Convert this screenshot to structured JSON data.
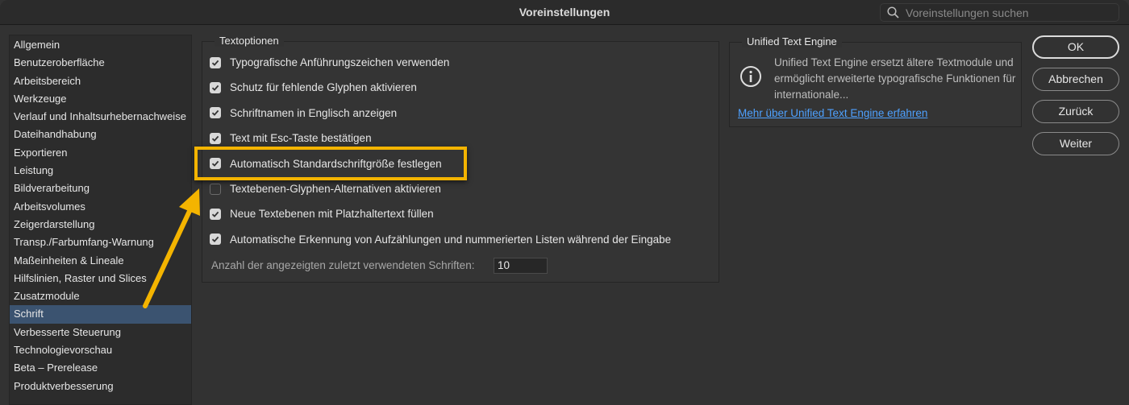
{
  "window": {
    "title": "Voreinstellungen",
    "search_placeholder": "Voreinstellungen suchen"
  },
  "sidebar": {
    "items": [
      "Allgemein",
      "Benutzeroberfläche",
      "Arbeitsbereich",
      "Werkzeuge",
      "Verlauf und Inhaltsurhebernachweise",
      "Dateihandhabung",
      "Exportieren",
      "Leistung",
      "Bildverarbeitung",
      "Arbeitsvolumes",
      "Zeigerdarstellung",
      "Transp./Farbumfang-Warnung",
      "Maßeinheiten & Lineale",
      "Hilfslinien, Raster und Slices",
      "Zusatzmodule",
      "Schrift",
      "Verbesserte Steuerung",
      "Technologievorschau",
      "Beta – Prerelease",
      "Produktverbesserung"
    ],
    "selected": "Schrift"
  },
  "textoptions": {
    "legend": "Textoptionen",
    "options": [
      {
        "label": "Typografische Anführungszeichen verwenden",
        "checked": true
      },
      {
        "label": "Schutz für fehlende Glyphen aktivieren",
        "checked": true
      },
      {
        "label": "Schriftnamen in Englisch anzeigen",
        "checked": true
      },
      {
        "label": "Text mit Esc-Taste bestätigen",
        "checked": true
      },
      {
        "label": "Automatisch Standardschriftgröße festlegen",
        "checked": true
      },
      {
        "label": "Textebenen-Glyphen-Alternativen aktivieren",
        "checked": false
      },
      {
        "label": "Neue Textebenen mit Platzhaltertext füllen",
        "checked": true
      },
      {
        "label": "Automatische Erkennung von Aufzählungen und nummerierten Listen während der Eingabe",
        "checked": true
      }
    ],
    "recent_fonts_label": "Anzahl der angezeigten zuletzt verwendeten Schriften:",
    "recent_fonts_value": "10"
  },
  "ute": {
    "legend": "Unified Text Engine",
    "description": "Unified Text Engine ersetzt ältere Textmodule und ermöglicht erweiterte typografische Funktionen für internationale...",
    "link": "Mehr über Unified Text Engine erfahren"
  },
  "buttons": {
    "ok": "OK",
    "cancel": "Abbrechen",
    "back": "Zurück",
    "next": "Weiter"
  },
  "colors": {
    "highlight": "#f4b400",
    "link": "#4ea1ff",
    "selection": "#3b5370"
  }
}
